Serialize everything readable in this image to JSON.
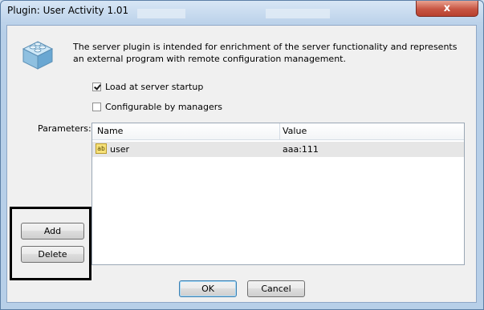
{
  "window": {
    "title": "Plugin: User Activity 1.01",
    "close_label": "x"
  },
  "description": "The server plugin is intended for enrichment of the server functionality and represents an external program with remote configuration management.",
  "options": [
    {
      "label": "Load at server startup",
      "checked": true
    },
    {
      "label": "Configurable by managers",
      "checked": false
    }
  ],
  "parameters": {
    "label": "Parameters:",
    "columns": [
      "Name",
      "Value"
    ],
    "rows": [
      {
        "icon": "ab",
        "name": "user",
        "value": "aaa:111"
      }
    ]
  },
  "buttons": {
    "add": "Add",
    "delete": "Delete",
    "ok": "OK",
    "cancel": "Cancel"
  },
  "colors": {
    "frame": "#b7cfe8",
    "close_button": "#c75543",
    "default_button_border": "#3c7fb1"
  }
}
